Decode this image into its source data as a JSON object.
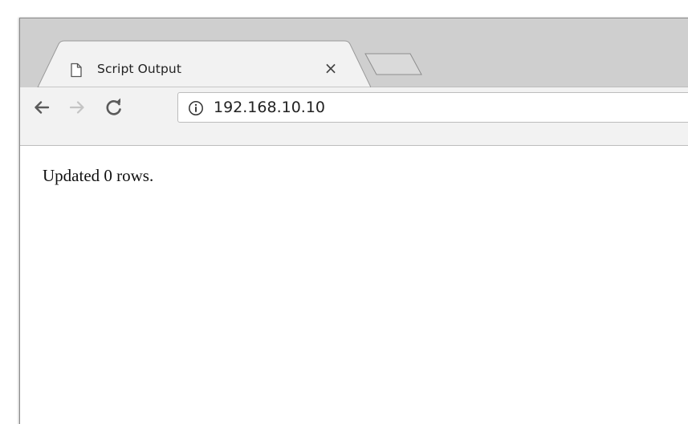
{
  "browser": {
    "tab": {
      "title": "Script Output",
      "close_label": "×",
      "icon": "page-icon"
    },
    "new_tab": {
      "icon": "new-tab-icon"
    },
    "toolbar": {
      "back_icon": "arrow-left-icon",
      "forward_icon": "arrow-right-icon",
      "reload_icon": "reload-icon",
      "forward_enabled": false
    },
    "omnibox": {
      "security_icon": "info-icon",
      "url": "192.168.10.10"
    }
  },
  "page": {
    "body_text": "Updated 0 rows."
  },
  "colors": {
    "titlebar": "#cfcfcf",
    "toolbar": "#f2f2f2",
    "active_icon": "#5a5a5a",
    "disabled_icon": "#c4c4c4"
  }
}
